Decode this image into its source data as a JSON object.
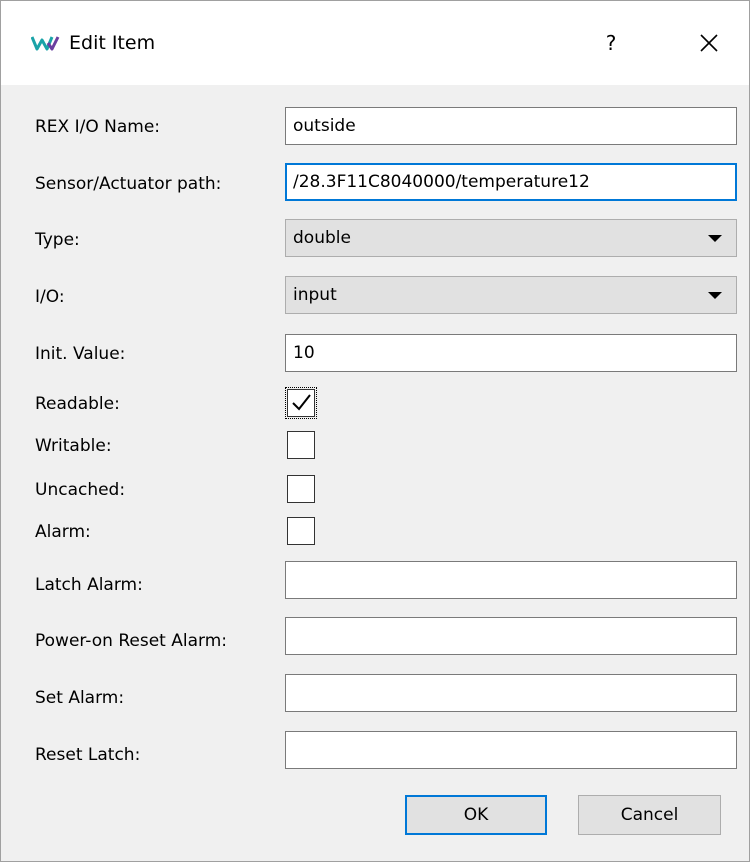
{
  "window": {
    "title": "Edit Item",
    "help_label": "?",
    "accent_color": "#0078d7"
  },
  "form": {
    "rex_io_name": {
      "label": "REX I/O Name:",
      "value": "outside"
    },
    "sensor_path": {
      "label": "Sensor/Actuator path:",
      "value": "/28.3F11C8040000/temperature12"
    },
    "type": {
      "label": "Type:",
      "selected": "double"
    },
    "io": {
      "label": "I/O:",
      "selected": "input"
    },
    "init_value": {
      "label": "Init. Value:",
      "value": "10"
    },
    "readable": {
      "label": "Readable:",
      "checked": true
    },
    "writable": {
      "label": "Writable:",
      "checked": false
    },
    "uncached": {
      "label": "Uncached:",
      "checked": false
    },
    "alarm": {
      "label": "Alarm:",
      "checked": false
    },
    "latch_alarm": {
      "label": "Latch Alarm:",
      "value": ""
    },
    "power_on_reset_alarm": {
      "label": "Power-on Reset Alarm:",
      "value": ""
    },
    "set_alarm": {
      "label": "Set Alarm:",
      "value": ""
    },
    "reset_latch": {
      "label": "Reset Latch:",
      "value": ""
    }
  },
  "buttons": {
    "ok_label": "OK",
    "cancel_label": "Cancel"
  },
  "icons": {
    "app": "rex-logo-icon",
    "help": "help-icon",
    "close": "close-icon",
    "dropdown": "chevron-down-icon",
    "check": "checkmark-icon"
  }
}
